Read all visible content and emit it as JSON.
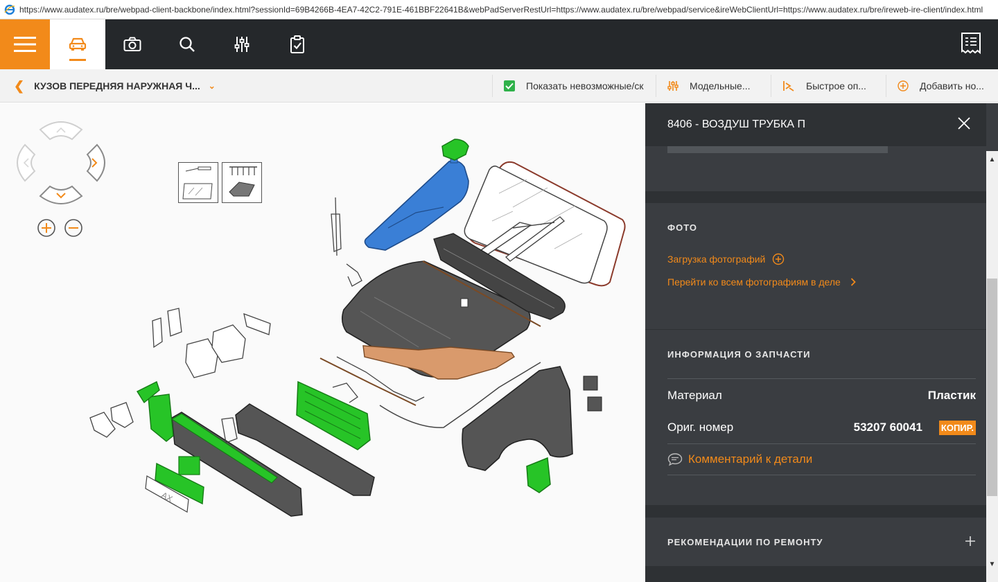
{
  "browser": {
    "url": "https://www.audatex.ru/bre/webpad-client-backbone/index.html?sessionId=69B4266B-4EA7-42C2-791E-461BBF22641B&webPadServerRestUrl=https://www.audatex.ru/bre/webpad/service&ireWebClientUrl=https://www.audatex.ru/bre/ireweb-ire-client/index.html"
  },
  "topbar": {
    "icons": [
      "menu-icon",
      "car-icon",
      "camera-icon",
      "search-icon",
      "sliders-icon",
      "clipboard-check-icon",
      "receipt-icon"
    ]
  },
  "toolbar": {
    "breadcrumb": "КУЗОВ ПЕРЕДНЯЯ НАРУЖНАЯ Ч...",
    "show_impossible": "Показать невозможные/ск",
    "model": "Модельные...",
    "quick": "Быстрое оп...",
    "add_new": "Добавить но..."
  },
  "panel": {
    "title": "8406 - ВОЗДУШ ТРУБКА П",
    "photo": {
      "heading": "ФОТО",
      "upload": "Загрузка фотографий",
      "goto_all": "Перейти ко всем фотографиям в деле"
    },
    "part_info": {
      "heading": "ИНФОРМАЦИЯ О ЗАПЧАСТИ",
      "material_label": "Материал",
      "material_value": "Пластик",
      "orig_label": "Ориг. номер",
      "orig_value": "53207 60041",
      "copy_label": "КОПИР.",
      "comment": "Комментарий к детали"
    },
    "repair": {
      "heading": "РЕКОМЕНДАЦИИ ПО РЕМОНТУ"
    }
  },
  "diagram": {
    "plate_text": "AX"
  },
  "colors": {
    "accent": "#f28a1a",
    "topbar": "#25282b",
    "panel": "#3a3d41",
    "highlight_blue": "#3a7fd6",
    "highlight_green": "#27c427"
  }
}
